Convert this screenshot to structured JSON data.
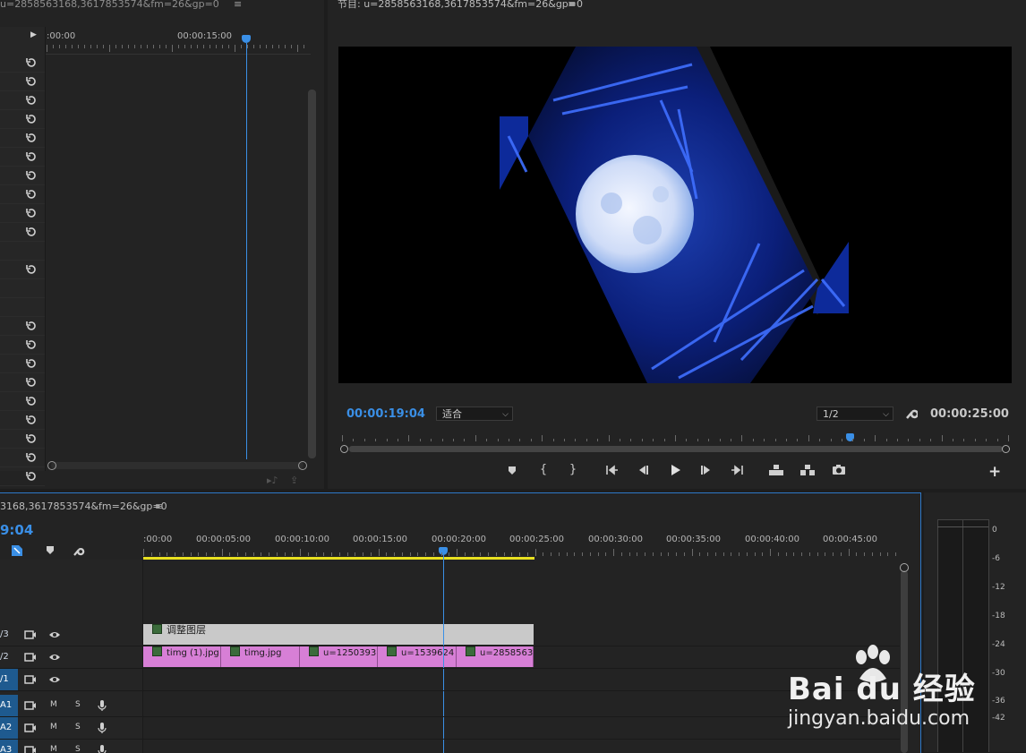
{
  "effect_controls": {
    "title": "u=2858563168,3617853574&fm=26&gp=0",
    "ruler_start": ":00:00",
    "ruler_mark": "00:00:15:00"
  },
  "program_monitor": {
    "title": "节目: u=2858563168,3617853574&fm=26&gp=0",
    "current_time": "00:00:19:04",
    "zoom_select": "适合",
    "resolution_select": "1/2",
    "duration": "00:00:25:00"
  },
  "timeline": {
    "title": "3168,3617853574&fm=26&gp=0",
    "current_time": "9:04",
    "ruler": [
      "00:00",
      "00:00:05:00",
      "00:00:10:00",
      "00:00:15:00",
      "00:00:20:00",
      "00:00:25:00",
      "00:00:30:00",
      "00:00:35:00",
      "00:00:40:00",
      "00:00:45:00"
    ],
    "tracks": [
      {
        "label": "/3",
        "has_eye": true
      },
      {
        "label": "/2",
        "has_eye": true
      },
      {
        "label": "/1",
        "has_eye": true
      },
      {
        "label": "A1",
        "m": "M",
        "s": "S"
      },
      {
        "label": "A2",
        "m": "M",
        "s": "S"
      },
      {
        "label": "A3",
        "m": "M",
        "s": "S"
      }
    ],
    "adjustment_clip": "调整图层",
    "clips": [
      "timg (1).jpg",
      "timg.jpg",
      "u=1250393",
      "u=1539624",
      "u=2858563"
    ]
  },
  "meters": {
    "labels": [
      "0",
      "-6",
      "-12",
      "-18",
      "-24",
      "-30",
      "-36",
      "-42"
    ]
  },
  "watermark": {
    "brand": "Bai du 经验",
    "url": "jingyan.baidu.com"
  },
  "colors": {
    "accent_blue": "#3a8fe6",
    "clip_pink": "#d77fd6",
    "adjustment_gray": "#c9c9c9",
    "work_area_yellow": "#e8e020"
  }
}
